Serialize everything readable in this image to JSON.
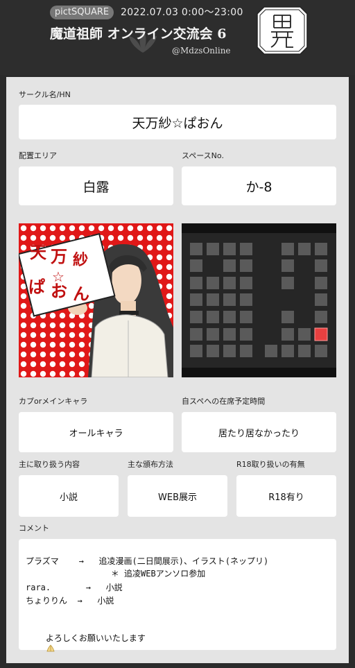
{
  "header": {
    "platform": "pictSQUARE",
    "date": "2022.07.03  0:00〜23:00",
    "event_title": "魔道祖師 オンライン交流会 6",
    "handle": "@MdzsOnline",
    "logo_icon": "event-seal-logo-icon"
  },
  "fields": {
    "circle_label": "サークル名/HN",
    "circle_value": "天万紗☆ぱおん",
    "area_label": "配置エリア",
    "area_value": "白露",
    "space_label": "スペースNo.",
    "space_value": "か-8",
    "cp_label": "カプorメインキャラ",
    "cp_value": "オールキャラ",
    "presence_label": "自スペへの在席予定時間",
    "presence_value": "居たり居なかったり",
    "content_label": "主に取り扱う内容",
    "content_value": "小説",
    "dist_label": "主な頒布方法",
    "dist_value": "WEB展示",
    "r18_label": "R18取り扱いの有無",
    "r18_value": "R18有り",
    "comment_label": "コメント"
  },
  "circle_cut": {
    "sign_text": [
      "天",
      "万",
      "紗",
      "☆",
      "ぱ",
      "お",
      "ん"
    ],
    "background_color": "#e01818",
    "icon": "character-illustration-icon"
  },
  "map": {
    "highlight_color": "#e84040",
    "tile_color": "#5a5a5a",
    "icon": "venue-map-icon"
  },
  "comment": {
    "lines": [
      "プラズマ    →   追凌漫画(二日間展示)、イラスト(ネップリ)",
      "                 ＊ 追凌WEBアンソロ参加",
      "rara.       →   小説",
      "ちょりりん  →   小説",
      "",
      "よろしくお願いいたします"
    ],
    "emoji_icon": "praying-hands-icon"
  },
  "colors": {
    "header_bg": "#2d2d2d",
    "panel_bg": "#e4e4e4"
  }
}
